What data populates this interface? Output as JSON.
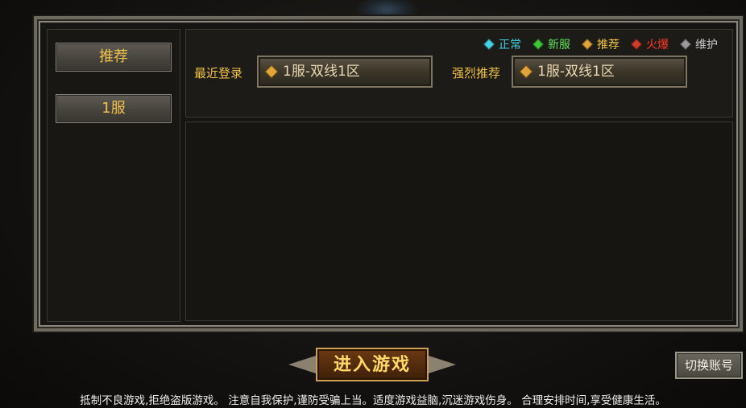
{
  "sidebar": {
    "items": [
      {
        "label": "推荐"
      },
      {
        "label": "1服"
      }
    ]
  },
  "legend": [
    {
      "label": "正常",
      "color": "#44d2e6",
      "text_color": "#44d2e6"
    },
    {
      "label": "新服",
      "color": "#3ec53a",
      "text_color": "#5fe35a"
    },
    {
      "label": "推荐",
      "color": "#e0a538",
      "text_color": "#f0c24a"
    },
    {
      "label": "火爆",
      "color": "#d23a2a",
      "text_color": "#ff3a24"
    },
    {
      "label": "维护",
      "color": "#9a9a9a",
      "text_color": "#c8c8c8"
    }
  ],
  "recent": {
    "label": "最近登录",
    "server": "1服-双线1区"
  },
  "recommended": {
    "label": "强烈推荐",
    "server": "1服-双线1区"
  },
  "enter_button": "进入游戏",
  "switch_account": "切换账号",
  "notice": "抵制不良游戏,拒绝盗版游戏。 注意自我保护,谨防受骗上当。适度游戏益脑,沉迷游戏伤身。 合理安排时间,享受健康生活。"
}
